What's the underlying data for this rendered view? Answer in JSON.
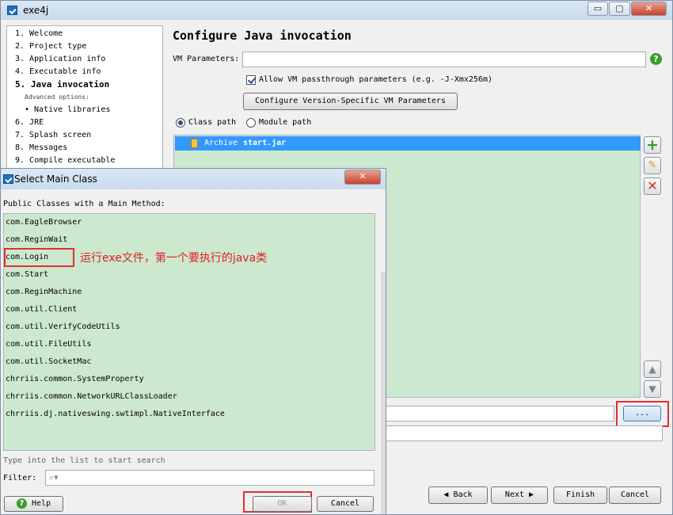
{
  "window": {
    "title": "exe4j",
    "minimize": "▭",
    "maximize": "▢",
    "close": "✕"
  },
  "nav": {
    "items": [
      {
        "label": "1. Welcome"
      },
      {
        "label": "2. Project type"
      },
      {
        "label": "3. Application info"
      },
      {
        "label": "4. Executable info"
      },
      {
        "label": "5. Java invocation"
      },
      {
        "label": "Advanced options:"
      },
      {
        "label": "• Native libraries"
      },
      {
        "label": "6. JRE"
      },
      {
        "label": "7. Splash screen"
      },
      {
        "label": "8. Messages"
      },
      {
        "label": "9. Compile executable"
      }
    ]
  },
  "page": {
    "title": "Configure Java invocation",
    "vm_label": "VM Parameters:",
    "vm_value": "",
    "passthrough_label": "Allow VM passthrough parameters (e.g. -J-Xmx256m)",
    "configure_vm_button": "Configure Version-Specific VM Parameters",
    "classpath_radio": "Class path",
    "modulepath_radio": "Module path",
    "classpath_entry_prefix": "Archive",
    "classpath_entry_file": "start.jar",
    "browse_button": "...",
    "help_glyph": "?"
  },
  "footer": {
    "back": "Back",
    "next": "Next",
    "finish": "Finish",
    "cancel": "Cancel"
  },
  "dialog": {
    "title": "Select Main Class",
    "close": "✕",
    "list_label": "Public Classes with a Main Method:",
    "classes": [
      "com.EagleBrowser",
      "com.ReginWait",
      "com.Login",
      "com.Start",
      "com.ReginMachine",
      "com.util.Client",
      "com.util.VerifyCodeUtils",
      "com.util.FileUtils",
      "com.util.SocketMac",
      "chrriis.common.SystemProperty",
      "chrriis.common.NetworkURLClassLoader",
      "chrriis.dj.nativeswing.swtimpl.NativeInterface"
    ],
    "search_hint": "Type into the list to start search",
    "filter_label": "Filter:",
    "help_button": "Help",
    "ok_button": "OK",
    "cancel_button": "Cancel"
  },
  "annotation": {
    "text": "运行exe文件，第一个要执行的java类",
    "color": "#e02020"
  }
}
